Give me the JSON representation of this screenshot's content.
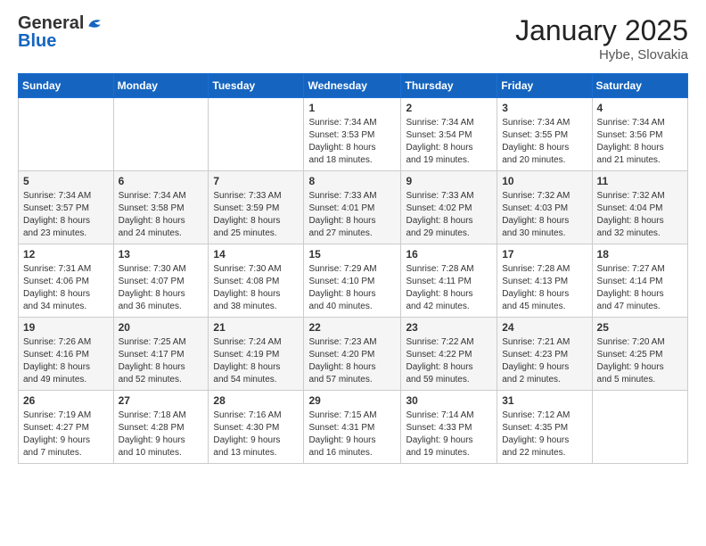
{
  "header": {
    "logo_general": "General",
    "logo_blue": "Blue",
    "month_year": "January 2025",
    "location": "Hybe, Slovakia"
  },
  "weekdays": [
    "Sunday",
    "Monday",
    "Tuesday",
    "Wednesday",
    "Thursday",
    "Friday",
    "Saturday"
  ],
  "weeks": [
    [
      {
        "day": "",
        "info": ""
      },
      {
        "day": "",
        "info": ""
      },
      {
        "day": "",
        "info": ""
      },
      {
        "day": "1",
        "info": "Sunrise: 7:34 AM\nSunset: 3:53 PM\nDaylight: 8 hours\nand 18 minutes."
      },
      {
        "day": "2",
        "info": "Sunrise: 7:34 AM\nSunset: 3:54 PM\nDaylight: 8 hours\nand 19 minutes."
      },
      {
        "day": "3",
        "info": "Sunrise: 7:34 AM\nSunset: 3:55 PM\nDaylight: 8 hours\nand 20 minutes."
      },
      {
        "day": "4",
        "info": "Sunrise: 7:34 AM\nSunset: 3:56 PM\nDaylight: 8 hours\nand 21 minutes."
      }
    ],
    [
      {
        "day": "5",
        "info": "Sunrise: 7:34 AM\nSunset: 3:57 PM\nDaylight: 8 hours\nand 23 minutes."
      },
      {
        "day": "6",
        "info": "Sunrise: 7:34 AM\nSunset: 3:58 PM\nDaylight: 8 hours\nand 24 minutes."
      },
      {
        "day": "7",
        "info": "Sunrise: 7:33 AM\nSunset: 3:59 PM\nDaylight: 8 hours\nand 25 minutes."
      },
      {
        "day": "8",
        "info": "Sunrise: 7:33 AM\nSunset: 4:01 PM\nDaylight: 8 hours\nand 27 minutes."
      },
      {
        "day": "9",
        "info": "Sunrise: 7:33 AM\nSunset: 4:02 PM\nDaylight: 8 hours\nand 29 minutes."
      },
      {
        "day": "10",
        "info": "Sunrise: 7:32 AM\nSunset: 4:03 PM\nDaylight: 8 hours\nand 30 minutes."
      },
      {
        "day": "11",
        "info": "Sunrise: 7:32 AM\nSunset: 4:04 PM\nDaylight: 8 hours\nand 32 minutes."
      }
    ],
    [
      {
        "day": "12",
        "info": "Sunrise: 7:31 AM\nSunset: 4:06 PM\nDaylight: 8 hours\nand 34 minutes."
      },
      {
        "day": "13",
        "info": "Sunrise: 7:30 AM\nSunset: 4:07 PM\nDaylight: 8 hours\nand 36 minutes."
      },
      {
        "day": "14",
        "info": "Sunrise: 7:30 AM\nSunset: 4:08 PM\nDaylight: 8 hours\nand 38 minutes."
      },
      {
        "day": "15",
        "info": "Sunrise: 7:29 AM\nSunset: 4:10 PM\nDaylight: 8 hours\nand 40 minutes."
      },
      {
        "day": "16",
        "info": "Sunrise: 7:28 AM\nSunset: 4:11 PM\nDaylight: 8 hours\nand 42 minutes."
      },
      {
        "day": "17",
        "info": "Sunrise: 7:28 AM\nSunset: 4:13 PM\nDaylight: 8 hours\nand 45 minutes."
      },
      {
        "day": "18",
        "info": "Sunrise: 7:27 AM\nSunset: 4:14 PM\nDaylight: 8 hours\nand 47 minutes."
      }
    ],
    [
      {
        "day": "19",
        "info": "Sunrise: 7:26 AM\nSunset: 4:16 PM\nDaylight: 8 hours\nand 49 minutes."
      },
      {
        "day": "20",
        "info": "Sunrise: 7:25 AM\nSunset: 4:17 PM\nDaylight: 8 hours\nand 52 minutes."
      },
      {
        "day": "21",
        "info": "Sunrise: 7:24 AM\nSunset: 4:19 PM\nDaylight: 8 hours\nand 54 minutes."
      },
      {
        "day": "22",
        "info": "Sunrise: 7:23 AM\nSunset: 4:20 PM\nDaylight: 8 hours\nand 57 minutes."
      },
      {
        "day": "23",
        "info": "Sunrise: 7:22 AM\nSunset: 4:22 PM\nDaylight: 8 hours\nand 59 minutes."
      },
      {
        "day": "24",
        "info": "Sunrise: 7:21 AM\nSunset: 4:23 PM\nDaylight: 9 hours\nand 2 minutes."
      },
      {
        "day": "25",
        "info": "Sunrise: 7:20 AM\nSunset: 4:25 PM\nDaylight: 9 hours\nand 5 minutes."
      }
    ],
    [
      {
        "day": "26",
        "info": "Sunrise: 7:19 AM\nSunset: 4:27 PM\nDaylight: 9 hours\nand 7 minutes."
      },
      {
        "day": "27",
        "info": "Sunrise: 7:18 AM\nSunset: 4:28 PM\nDaylight: 9 hours\nand 10 minutes."
      },
      {
        "day": "28",
        "info": "Sunrise: 7:16 AM\nSunset: 4:30 PM\nDaylight: 9 hours\nand 13 minutes."
      },
      {
        "day": "29",
        "info": "Sunrise: 7:15 AM\nSunset: 4:31 PM\nDaylight: 9 hours\nand 16 minutes."
      },
      {
        "day": "30",
        "info": "Sunrise: 7:14 AM\nSunset: 4:33 PM\nDaylight: 9 hours\nand 19 minutes."
      },
      {
        "day": "31",
        "info": "Sunrise: 7:12 AM\nSunset: 4:35 PM\nDaylight: 9 hours\nand 22 minutes."
      },
      {
        "day": "",
        "info": ""
      }
    ]
  ]
}
